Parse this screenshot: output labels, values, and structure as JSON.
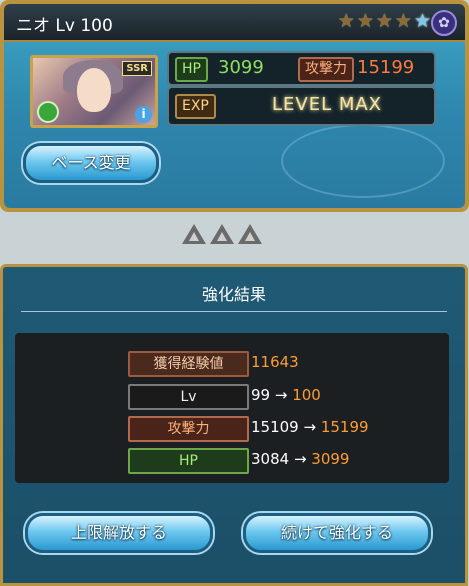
{
  "character": {
    "name_level": "ニオ Lv 100",
    "rarity": "SSR",
    "hp_label": "HP",
    "hp_value": "3099",
    "atk_label": "攻撃力",
    "atk_value": "15199",
    "exp_label": "EXP",
    "exp_status": "LEVEL MAX",
    "base_change_button": "ベース変更",
    "star_count": 5
  },
  "result": {
    "title": "強化結果",
    "rows": [
      {
        "label": "獲得経験値",
        "value": "11643",
        "from": "",
        "to": ""
      },
      {
        "label": "Lv",
        "value": "",
        "from": "99 →",
        "to": "100"
      },
      {
        "label": "攻撃力",
        "value": "",
        "from": "15109 →",
        "to": "15199"
      },
      {
        "label": "HP",
        "value": "",
        "from": "3084 →",
        "to": "3099"
      }
    ],
    "uncap_button": "上限解放する",
    "continue_button": "続けて強化する"
  },
  "colors": {
    "accent_gold": "#b9933f",
    "panel_blue": "#2e86ad",
    "value_orange": "#ff9c33"
  }
}
